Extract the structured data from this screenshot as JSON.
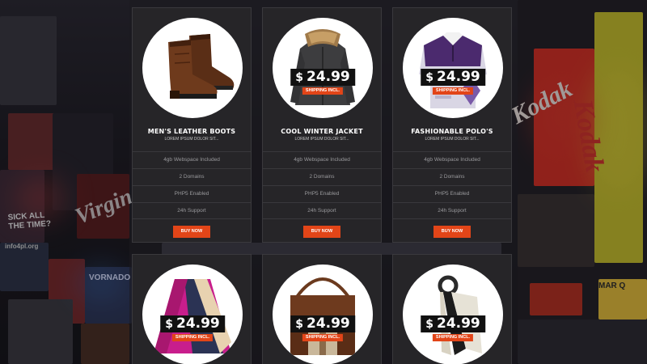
{
  "background": {
    "signs": {
      "virgin": "Virgin",
      "kodak_1": "Kodak",
      "kodak_2": "Kodak",
      "sick": "SICK ALL\nTHE TIME?",
      "info": "info4pl.org",
      "vornado": "VORNADO",
      "marquee": "MAR Q"
    }
  },
  "products": [
    {
      "name": "MEN'S LEATHER BOOTS",
      "subtitle": "LOREM IPSUM DOLOR SIT...",
      "show_price": false,
      "image_icon": "boots-icon",
      "features": [
        "4gb Webspace Included",
        "2 Domains",
        "PHP5 Enabled",
        "24h Support"
      ],
      "button": "BUY NOW"
    },
    {
      "name": "COOL WINTER JACKET",
      "subtitle": "LOREM IPSUM DOLOR SIT...",
      "currency": "$",
      "price": "24.99",
      "shipping": "SHIPPING INCL.",
      "image_icon": "jacket-icon",
      "features": [
        "4gb Webspace Included",
        "2 Domains",
        "PHP5 Enabled",
        "24h Support"
      ],
      "button": "BUY NOW"
    },
    {
      "name": "FASHIONABLE POLO'S",
      "subtitle": "LOREM IPSUM DOLOR SIT...",
      "currency": "$",
      "price": "24.99",
      "shipping": "SHIPPING INCL.",
      "image_icon": "polo-shirt-icon",
      "features": [
        "4gb Webspace Included",
        "2 Domains",
        "PHP5 Enabled",
        "24h Support"
      ],
      "button": "BUY NOW"
    },
    {
      "currency": "$",
      "price": "24.99",
      "shipping": "SHIPPING INCL.",
      "image_icon": "poncho-icon"
    },
    {
      "currency": "$",
      "price": "24.99",
      "shipping": "SHIPPING INCL.",
      "image_icon": "leather-bag-icon"
    },
    {
      "currency": "$",
      "price": "24.99",
      "shipping": "SHIPPING INCL.",
      "image_icon": "scarf-icon"
    }
  ],
  "colors": {
    "accent": "#e24518",
    "card_bg": "#262528",
    "page_bg": "#1c1a1f"
  }
}
